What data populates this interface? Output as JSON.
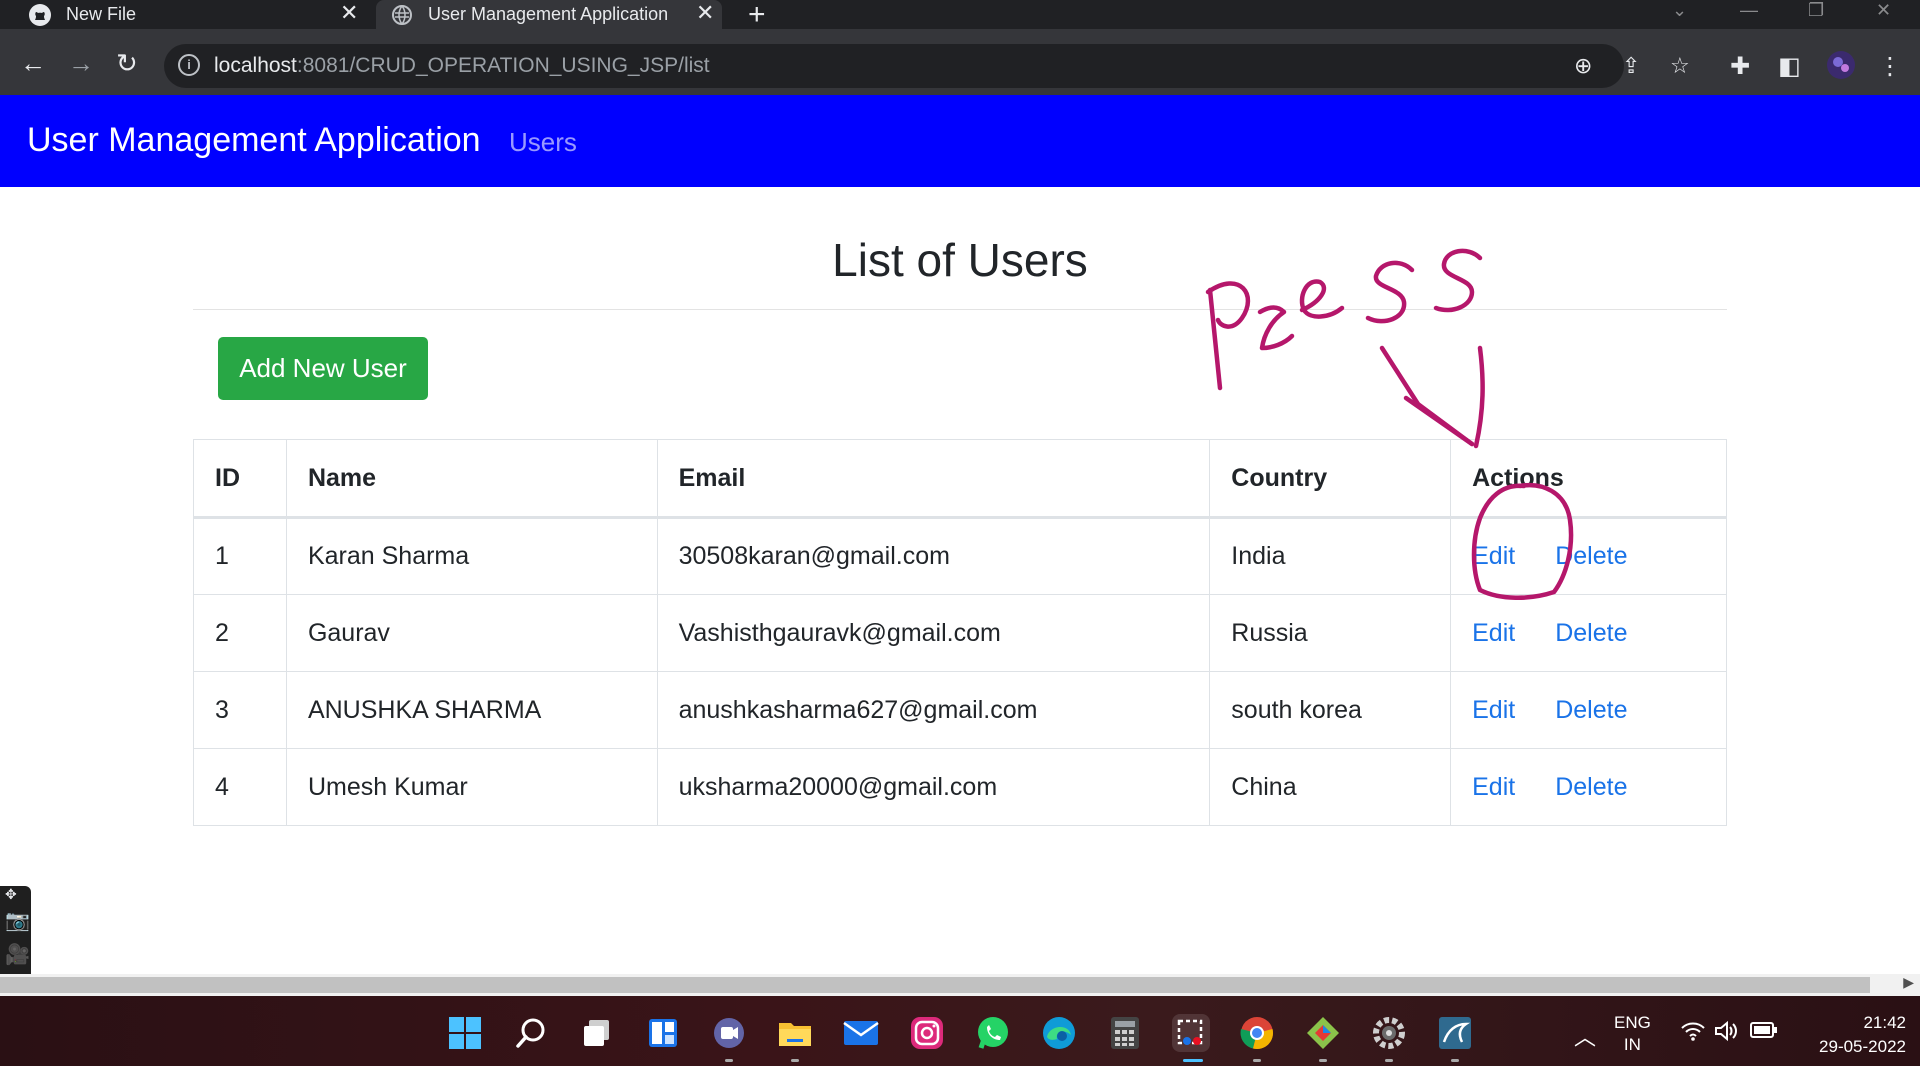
{
  "browser": {
    "tabs": [
      {
        "title": "New File"
      },
      {
        "title": "User Management Application"
      }
    ],
    "url_host": "localhost",
    "url_rest": ":8081/CRUD_OPERATION_USING_JSP/list"
  },
  "navbar": {
    "brand": "User Management Application",
    "link": "Users"
  },
  "main": {
    "title": "List of Users",
    "add_button": "Add New User",
    "table": {
      "headers": [
        "ID",
        "Name",
        "Email",
        "Country",
        "Actions"
      ],
      "rows": [
        {
          "id": "1",
          "name": "Karan Sharma",
          "email": "30508karan@gmail.com",
          "country": "India"
        },
        {
          "id": "2",
          "name": "Gaurav",
          "email": "Vashisthgauravk@gmail.com",
          "country": "Russia"
        },
        {
          "id": "3",
          "name": "ANUSHKA SHARMA",
          "email": "anushkasharma627@gmail.com",
          "country": "south korea"
        },
        {
          "id": "4",
          "name": "Umesh Kumar",
          "email": "uksharma20000@gmail.com",
          "country": "China"
        }
      ],
      "edit_label": "Edit",
      "delete_label": "Delete"
    }
  },
  "taskbar": {
    "lang_top": "ENG",
    "lang_bottom": "IN",
    "time": "21:42",
    "date": "29-05-2022"
  },
  "colors": {
    "navbar": "#0000ff",
    "add_button": "#28a745",
    "link": "#1a73e8",
    "annotation": "#b5176b"
  }
}
